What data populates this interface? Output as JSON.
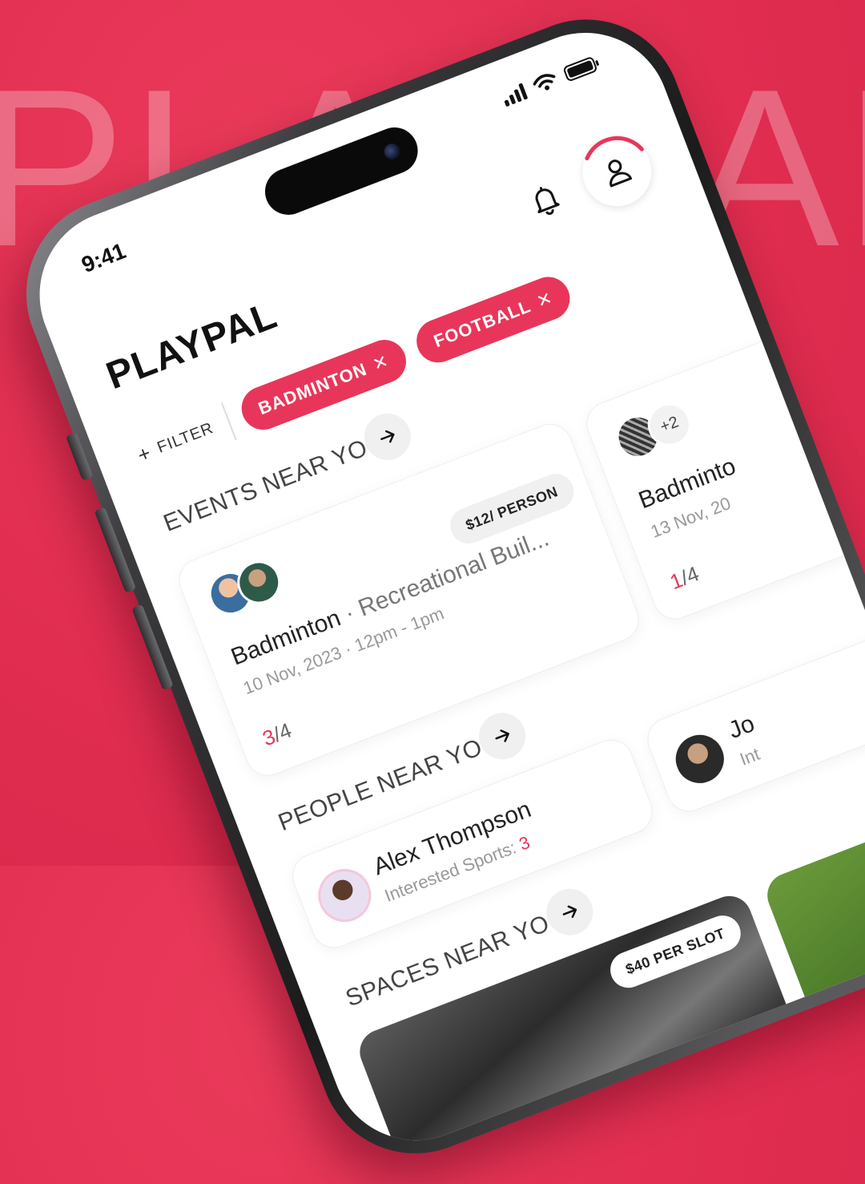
{
  "background_word": "PLAYPAL",
  "colors": {
    "accent": "#e8365a",
    "background": "#e02d50"
  },
  "status_bar": {
    "time": "9:41"
  },
  "header": {
    "brand": "PLAYPAL"
  },
  "filters": {
    "filter_label": "FILTER",
    "chips": [
      "BADMINTON",
      "FOOTBALL"
    ]
  },
  "events": {
    "title": "EVENTS NEAR YOU",
    "cards": [
      {
        "sport": "Badminton",
        "venue": "Recreational Buil...",
        "date": "10 Nov, 2023 · 12pm - 1pm",
        "price": "$12/ PERSON",
        "filled": "3",
        "total": "/4"
      },
      {
        "sport": "Badminto",
        "date": "13 Nov, 20",
        "extra": "+2",
        "filled": "1",
        "total": "/4"
      }
    ]
  },
  "people": {
    "title": "PEOPLE NEAR YOU",
    "cards": [
      {
        "name": "Alex Thompson",
        "interest_label": "Interested Sports:",
        "interest_count": "3"
      },
      {
        "name": "Jo",
        "interest_label": "Int"
      }
    ]
  },
  "spaces": {
    "title": "SPACES NEAR YOU",
    "price": "$40 PER SLOT"
  }
}
